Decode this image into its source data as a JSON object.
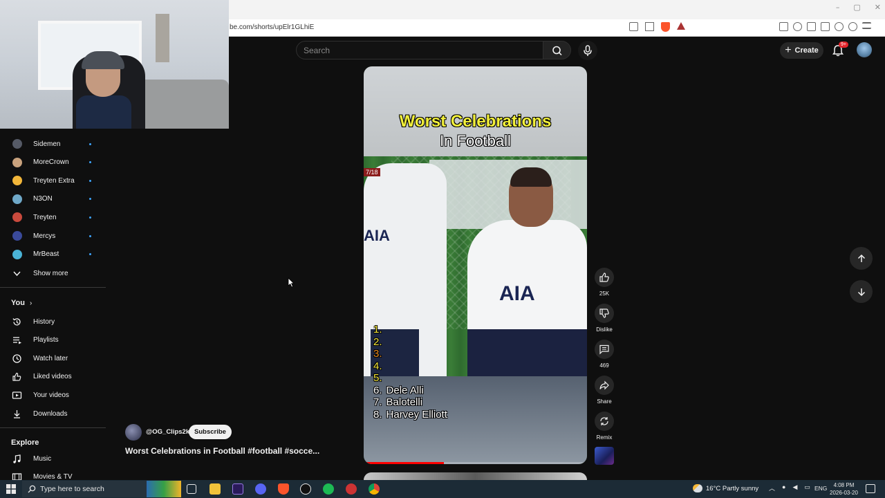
{
  "browser": {
    "url": "be.com/shorts/upElr1GLhiE",
    "window_controls": [
      "–",
      "▢",
      "✕"
    ]
  },
  "header": {
    "search_placeholder": "Search",
    "create_label": "Create",
    "notifications_badge": "9+"
  },
  "sidebar": {
    "subscriptions": [
      {
        "label": "Sidemen",
        "color": "#555a66"
      },
      {
        "label": "MoreCrown",
        "color": "#c9a27d"
      },
      {
        "label": "Treyten Extra",
        "color": "#f2b63a"
      },
      {
        "label": "N3ON",
        "color": "#6fa8c8"
      },
      {
        "label": "Treyten",
        "color": "#c94a3d"
      },
      {
        "label": "Mercys",
        "color": "#3a4a9a"
      },
      {
        "label": "MrBeast",
        "color": "#4ab3d6"
      }
    ],
    "show_more": "Show more",
    "you_heading": "You",
    "you_items": [
      {
        "label": "History",
        "icon": "history-icon"
      },
      {
        "label": "Playlists",
        "icon": "playlists-icon"
      },
      {
        "label": "Watch later",
        "icon": "clock-icon"
      },
      {
        "label": "Liked videos",
        "icon": "thumbs-up-icon"
      },
      {
        "label": "Your videos",
        "icon": "play-icon"
      },
      {
        "label": "Downloads",
        "icon": "download-icon"
      }
    ],
    "explore_heading": "Explore",
    "explore_items": [
      {
        "label": "Music",
        "icon": "music-icon"
      },
      {
        "label": "Movies & TV",
        "icon": "film-icon"
      }
    ]
  },
  "short": {
    "overlay_title_line1": "Worst Celebrations",
    "overlay_title_line2": "In Football",
    "counter_tag": "7/18",
    "sponsor_text": "AIA",
    "ranking": [
      {
        "num": "1.",
        "name": ""
      },
      {
        "num": "2.",
        "name": ""
      },
      {
        "num": "3.",
        "name": ""
      },
      {
        "num": "4.",
        "name": ""
      },
      {
        "num": "5.",
        "name": ""
      },
      {
        "num": "6.",
        "name": "Dele Alli"
      },
      {
        "num": "7.",
        "name": "Balotelli"
      },
      {
        "num": "8.",
        "name": "Harvey Elliott"
      }
    ],
    "progress_fraction": 0.36
  },
  "actions": {
    "like_count": "25K",
    "dislike_label": "Dislike",
    "comment_count": "469",
    "share_label": "Share",
    "remix_label": "Remix"
  },
  "channel": {
    "handle": "@OG_Clips2k",
    "subscribe_label": "Subscribe",
    "video_title": "Worst Celebrations in Football #football #socce..."
  },
  "taskbar": {
    "search_placeholder": "Type here to search",
    "weather": "16°C  Partly sunny",
    "language": "ENG",
    "time": "4:08 PM",
    "date": "2026-03-20"
  }
}
